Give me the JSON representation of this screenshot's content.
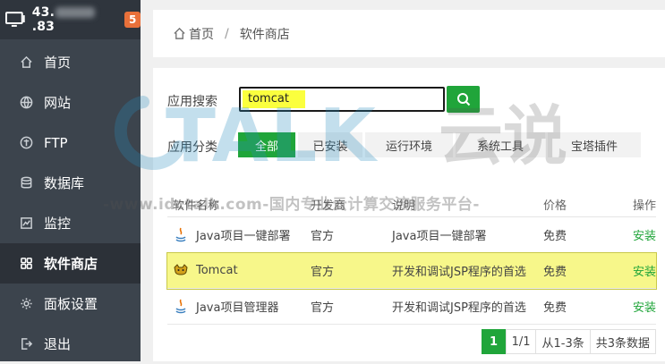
{
  "sidebar": {
    "ip_prefix": "43.",
    "ip_suffix": ".83",
    "badge": "5",
    "items": [
      {
        "label": "首页",
        "icon": "home-icon"
      },
      {
        "label": "网站",
        "icon": "globe-icon"
      },
      {
        "label": "FTP",
        "icon": "ftp-icon"
      },
      {
        "label": "数据库",
        "icon": "database-icon"
      },
      {
        "label": "监控",
        "icon": "monitor-chart-icon"
      },
      {
        "label": "软件商店",
        "icon": "apps-grid-icon",
        "active": true
      },
      {
        "label": "面板设置",
        "icon": "gear-icon"
      },
      {
        "label": "退出",
        "icon": "logout-icon"
      }
    ]
  },
  "breadcrumb": {
    "home": "首页",
    "separator": "/",
    "current": "软件商店"
  },
  "search": {
    "label": "应用搜索",
    "value": "tomcat"
  },
  "category": {
    "label": "应用分类",
    "tabs": [
      {
        "label": "全部",
        "active": true
      },
      {
        "label": "已安装"
      },
      {
        "label": "运行环境"
      },
      {
        "label": "系统工具"
      },
      {
        "label": "宝塔插件"
      }
    ]
  },
  "table": {
    "headers": [
      "软件名称",
      "开发商",
      "说明",
      "价格",
      "操作"
    ],
    "rows": [
      {
        "name": "Java项目一键部署",
        "dev": "官方",
        "desc": "Java项目一键部署",
        "price": "免费",
        "op": "安装",
        "icon": "java-icon"
      },
      {
        "name": "Tomcat",
        "dev": "官方",
        "desc": "开发和调试JSP程序的首选",
        "price": "免费",
        "op": "安装",
        "icon": "tomcat-icon",
        "highlight": true
      },
      {
        "name": "Java项目管理器",
        "dev": "官方",
        "desc": "开发和调试JSP程序的首选",
        "price": "免费",
        "op": "安装",
        "icon": "java-icon"
      }
    ]
  },
  "pager": {
    "current": "1",
    "pages": "1/1",
    "range": "从1-3条",
    "total": "共3条数据"
  },
  "watermark": {
    "brand": "TALK",
    "brand_cn": "云说",
    "url": "-www.idctalk.com-国内专业云计算交流服务平台-"
  },
  "colors": {
    "sidebar_bg": "#3c444d",
    "accent_green": "#20a53a",
    "badge_orange": "#e8703a",
    "highlight_yellow": "#f7f78a"
  }
}
